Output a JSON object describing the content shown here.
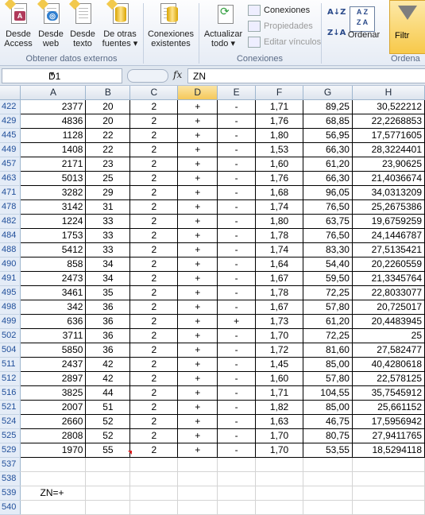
{
  "ribbon": {
    "buttons": [
      {
        "l1": "Desde",
        "l2": "Access"
      },
      {
        "l1": "Desde",
        "l2": "web"
      },
      {
        "l1": "Desde",
        "l2": "texto"
      },
      {
        "l1": "De otras",
        "l2": "fuentes ▾"
      },
      {
        "l1": "Conexiones",
        "l2": "existentes"
      },
      {
        "l1": "Actualizar",
        "l2": "todo ▾"
      }
    ],
    "small": [
      "Conexiones",
      "Propiedades",
      "Editar vínculos"
    ],
    "sort_label": "Ordenar",
    "filter_label": "Filtr",
    "groups": [
      "Obtener datos externos",
      "Conexiones",
      "Ordena"
    ]
  },
  "formula_bar": {
    "name_box": "D1",
    "fx": "fx",
    "content": "ZN"
  },
  "columns": [
    "A",
    "B",
    "C",
    "D",
    "E",
    "F",
    "G",
    "H"
  ],
  "active_column": "D",
  "rows": [
    {
      "n": "422",
      "v": [
        "2377",
        "20",
        "2",
        "+",
        "-",
        "1,71",
        "89,25",
        "30,522212"
      ]
    },
    {
      "n": "429",
      "v": [
        "4836",
        "20",
        "2",
        "+",
        "-",
        "1,76",
        "68,85",
        "22,2268853"
      ]
    },
    {
      "n": "445",
      "v": [
        "1128",
        "22",
        "2",
        "+",
        "-",
        "1,80",
        "56,95",
        "17,5771605"
      ]
    },
    {
      "n": "449",
      "v": [
        "1408",
        "22",
        "2",
        "+",
        "-",
        "1,53",
        "66,30",
        "28,3224401"
      ]
    },
    {
      "n": "457",
      "v": [
        "2171",
        "23",
        "2",
        "+",
        "-",
        "1,60",
        "61,20",
        "23,90625"
      ]
    },
    {
      "n": "463",
      "v": [
        "5013",
        "25",
        "2",
        "+",
        "-",
        "1,76",
        "66,30",
        "21,4036674"
      ]
    },
    {
      "n": "471",
      "v": [
        "3282",
        "29",
        "2",
        "+",
        "-",
        "1,68",
        "96,05",
        "34,0313209"
      ]
    },
    {
      "n": "478",
      "v": [
        "3142",
        "31",
        "2",
        "+",
        "-",
        "1,74",
        "76,50",
        "25,2675386"
      ]
    },
    {
      "n": "482",
      "v": [
        "1224",
        "33",
        "2",
        "+",
        "-",
        "1,80",
        "63,75",
        "19,6759259"
      ]
    },
    {
      "n": "484",
      "v": [
        "1753",
        "33",
        "2",
        "+",
        "-",
        "1,78",
        "76,50",
        "24,1446787"
      ]
    },
    {
      "n": "488",
      "v": [
        "5412",
        "33",
        "2",
        "+",
        "-",
        "1,74",
        "83,30",
        "27,5135421"
      ]
    },
    {
      "n": "490",
      "v": [
        "858",
        "34",
        "2",
        "+",
        "-",
        "1,64",
        "54,40",
        "20,2260559"
      ]
    },
    {
      "n": "491",
      "v": [
        "2473",
        "34",
        "2",
        "+",
        "-",
        "1,67",
        "59,50",
        "21,3345764"
      ]
    },
    {
      "n": "495",
      "v": [
        "3461",
        "35",
        "2",
        "+",
        "-",
        "1,78",
        "72,25",
        "22,8033077"
      ]
    },
    {
      "n": "498",
      "v": [
        "342",
        "36",
        "2",
        "+",
        "-",
        "1,67",
        "57,80",
        "20,725017"
      ]
    },
    {
      "n": "499",
      "v": [
        "636",
        "36",
        "2",
        "+",
        "+",
        "1,73",
        "61,20",
        "20,4483945"
      ]
    },
    {
      "n": "502",
      "v": [
        "3711",
        "36",
        "2",
        "+",
        "-",
        "1,70",
        "72,25",
        "25"
      ]
    },
    {
      "n": "504",
      "v": [
        "5850",
        "36",
        "2",
        "+",
        "-",
        "1,72",
        "81,60",
        "27,582477"
      ]
    },
    {
      "n": "511",
      "v": [
        "2437",
        "42",
        "2",
        "+",
        "-",
        "1,45",
        "85,00",
        "40,4280618"
      ]
    },
    {
      "n": "512",
      "v": [
        "2897",
        "42",
        "2",
        "+",
        "-",
        "1,60",
        "57,80",
        "22,578125"
      ]
    },
    {
      "n": "516",
      "v": [
        "3825",
        "44",
        "2",
        "+",
        "-",
        "1,71",
        "104,55",
        "35,7545912"
      ]
    },
    {
      "n": "521",
      "v": [
        "2007",
        "51",
        "2",
        "+",
        "-",
        "1,82",
        "85,00",
        "25,661152"
      ]
    },
    {
      "n": "524",
      "v": [
        "2660",
        "52",
        "2",
        "+",
        "-",
        "1,63",
        "46,75",
        "17,5956942"
      ]
    },
    {
      "n": "525",
      "v": [
        "2808",
        "52",
        "2",
        "+",
        "-",
        "1,70",
        "80,75",
        "27,9411765"
      ]
    },
    {
      "n": "529",
      "v": [
        "1970",
        "55",
        "2",
        "+",
        "-",
        "1,70",
        "53,55",
        "18,5294118"
      ]
    }
  ],
  "empty_rows": [
    "537",
    "538"
  ],
  "note_row": {
    "n": "539",
    "text": "ZN=+"
  },
  "last_row": "540"
}
